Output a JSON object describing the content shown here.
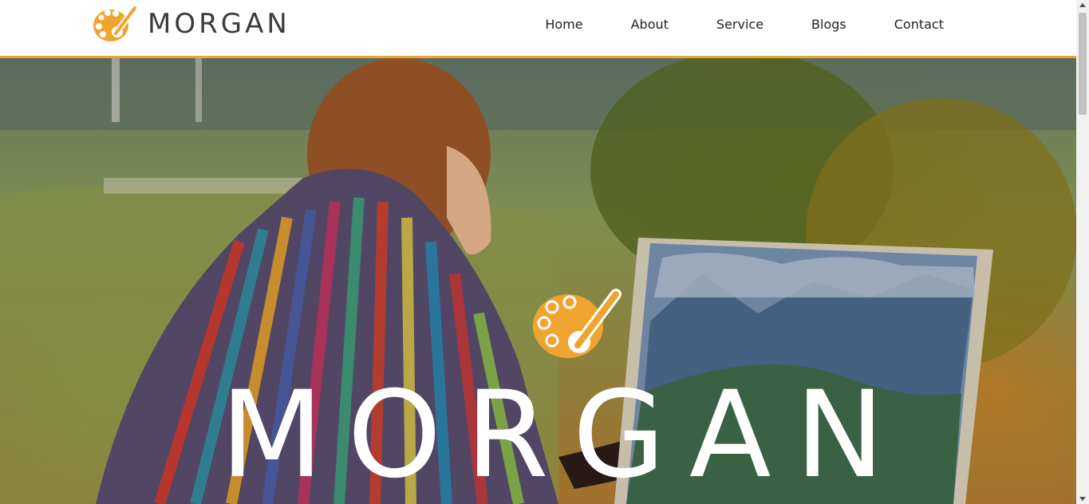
{
  "brand": {
    "name": "MORGAN",
    "logo_icon": "palette-brush-icon",
    "accent_color": "#f0a430"
  },
  "nav": {
    "items": [
      {
        "label": "Home"
      },
      {
        "label": "About"
      },
      {
        "label": "Service"
      },
      {
        "label": "Blogs"
      },
      {
        "label": "Contact"
      }
    ]
  },
  "hero": {
    "title": "MORGAN",
    "logo_icon": "palette-brush-icon",
    "background_image": "woman-painting-landscape-on-easel-photo"
  },
  "scrollbar": {
    "icon_up": "scroll-up-arrow-icon",
    "icon_down": "scroll-down-arrow-icon"
  }
}
